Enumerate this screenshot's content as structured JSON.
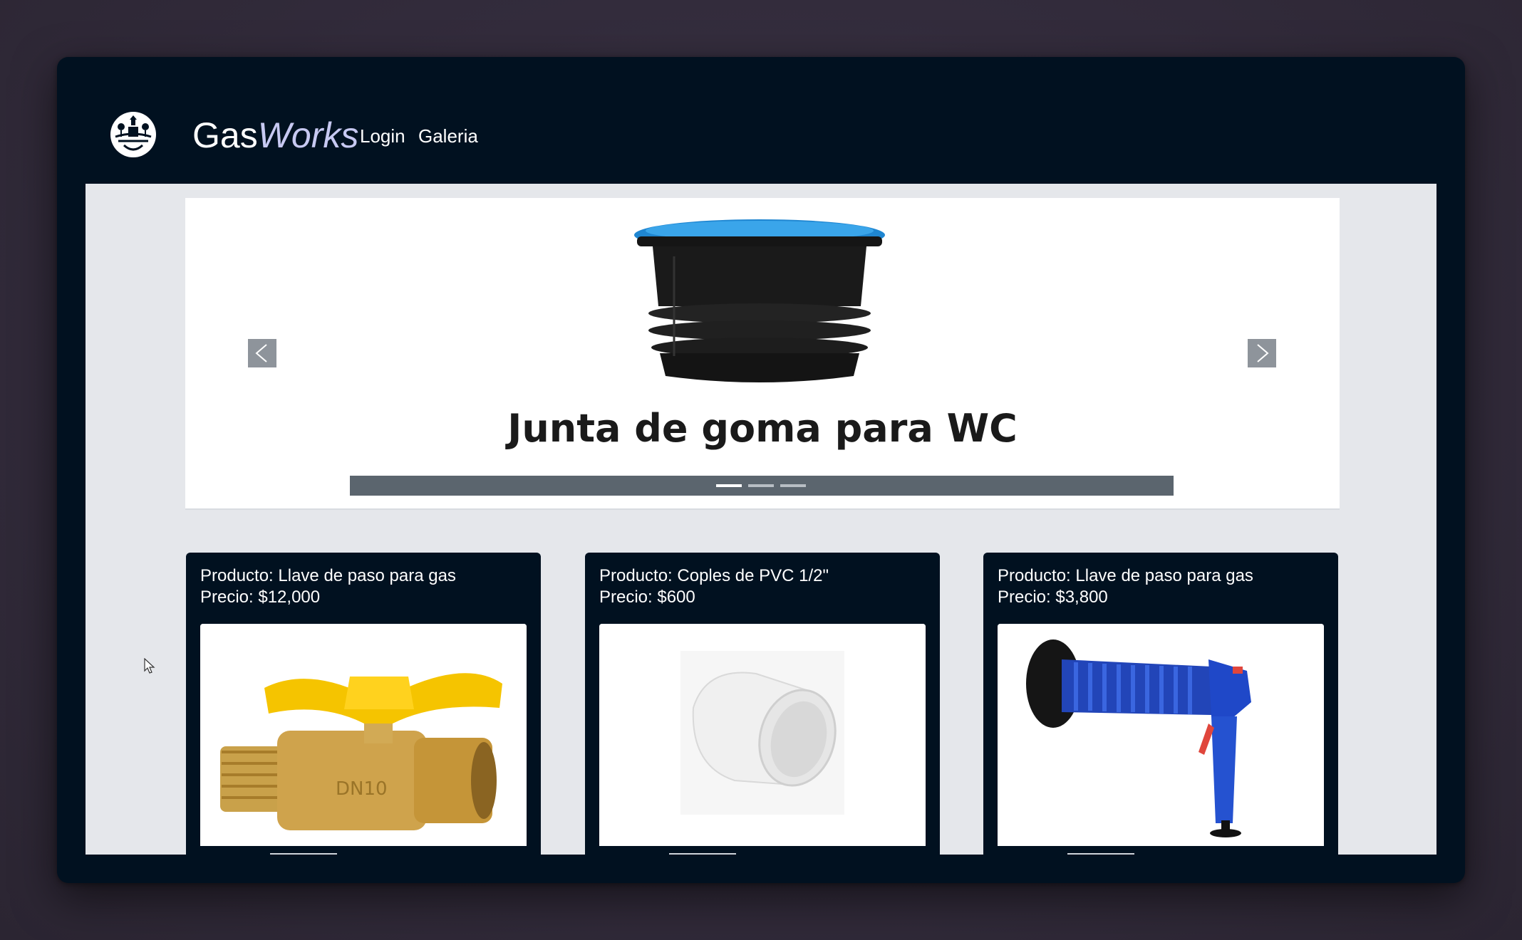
{
  "navbar": {
    "brand_prefix": "Gas",
    "brand_suffix": "Works",
    "links": [
      {
        "label": "Login"
      },
      {
        "label": "Galeria"
      }
    ]
  },
  "carousel": {
    "slide_title": "Junta de goma para WC",
    "slide_count": 3,
    "active_slide": 1,
    "prev_icon": "chevron-left-icon",
    "next_icon": "chevron-right-icon"
  },
  "products": [
    {
      "line1": "Producto: Llave de paso para gas",
      "line2": "Precio: $12,000",
      "image": "brass-gas-valve-image"
    },
    {
      "line1": "Producto: Coples de PVC 1/2\"",
      "line2": "Precio: $600",
      "image": "pvc-coupling-image"
    },
    {
      "line1": "Producto: Llave de paso para gas",
      "line2": "Precio: $3,800",
      "image": "drain-plunger-gun-image"
    }
  ],
  "colors": {
    "window_bg": "#011120",
    "content_bg": "#e5e7eb",
    "brand_accent": "#c7c9f2",
    "carousel_bar": "#5b656e"
  }
}
